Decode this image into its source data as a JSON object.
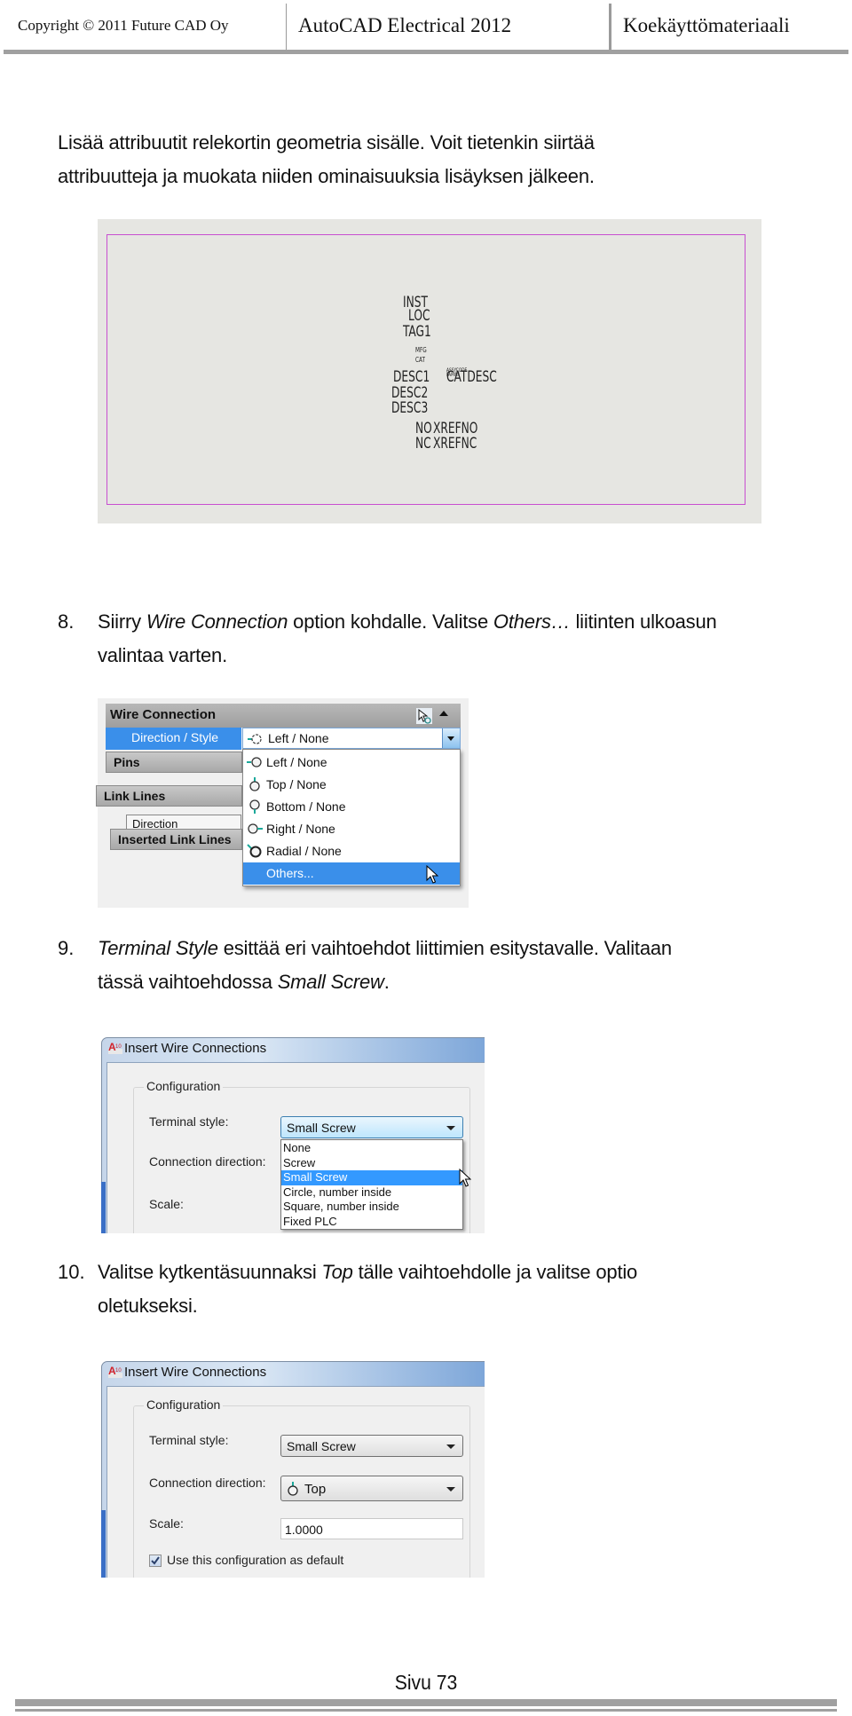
{
  "header": {
    "copyright": "Copyright © 2011 Future CAD Oy",
    "title": "AutoCAD Electrical 2012",
    "subtitle": "Koekäyttömateriaali"
  },
  "intro": {
    "line1": "Lisää attribuutit relekortin geometria sisälle. Voit tietenkin  siirtää",
    "line2": "attribuutteja ja muokata niiden ominaisuuksia lisäyksen jälkeen."
  },
  "cad_figure": {
    "frame_color": "#c84fd0",
    "attributes": {
      "inst": "INST",
      "loc": "LOC",
      "tag1": "TAG1",
      "mfg": "MFG",
      "cat": "CAT",
      "desc1": "DESC1",
      "desc2": "DESC2",
      "desc3": "DESC3",
      "assycode": "ASSYCODE",
      "family": "FAMILY",
      "catdesc": "CATDESC",
      "no": "NO",
      "xrefno": "XREFNO",
      "nc": "NC",
      "xrefnc": "XREFNC"
    }
  },
  "step8": {
    "number": "8.",
    "t1": "Siirry ",
    "t2_italic": "Wire Connection",
    "t3": " option kohdalle. Valitse ",
    "t4_italic": "Others…",
    "t5": " liitinten ulkoasun",
    "line2": "valintaa varten."
  },
  "wire_panel": {
    "header": "Wire Connection",
    "header_icons": [
      "pick-icon",
      "collapse-up-icon"
    ],
    "row_label": "Direction / Style",
    "combo_value": "Left / None",
    "sections": [
      "Pins",
      "Link Lines",
      "Inserted Link Lines"
    ],
    "direction_label": "Direction",
    "options": [
      {
        "label": "Left / None",
        "icon": "left-connection-icon"
      },
      {
        "label": "Top / None",
        "icon": "top-connection-icon"
      },
      {
        "label": "Bottom / None",
        "icon": "bottom-connection-icon"
      },
      {
        "label": "Right / None",
        "icon": "right-connection-icon"
      },
      {
        "label": "Radial / None",
        "icon": "radial-connection-icon"
      },
      {
        "label": "Others...",
        "icon": ""
      }
    ],
    "selected_option": "Others...",
    "accent": "#3a8fea"
  },
  "step9": {
    "number": "9.",
    "t1_italic": "Terminal Style",
    "t2": " esittää eri vaihtoehdot liittimien esitystavalle. Valitaan",
    "t3": "tässä vaihtoehdossa ",
    "t4_italic": "Small Screw",
    "t5": "."
  },
  "dialog1": {
    "title": "Insert Wire Connections",
    "group": "Configuration",
    "terminal_style_label": "Terminal style:",
    "terminal_style_value": "Small Screw",
    "connection_direction_label": "Connection direction:",
    "scale_label": "Scale:",
    "options": [
      "None",
      "Screw",
      "Small Screw",
      "Circle, number inside",
      "Square, number inside",
      "Fixed PLC"
    ],
    "selected_option": "Small Screw"
  },
  "step10": {
    "number": "10.",
    "t1": "Valitse kytkentäsuunnaksi ",
    "t2_italic": "Top",
    "t3": " tälle vaihtoehdolle ja valitse optio",
    "line2": "oletukseksi."
  },
  "dialog2": {
    "title": "Insert Wire Connections",
    "group": "Configuration",
    "terminal_style_label": "Terminal style:",
    "terminal_style_value": "Small Screw",
    "connection_direction_label": "Connection direction:",
    "connection_direction_value": "Top",
    "scale_label": "Scale:",
    "scale_value": "1.0000",
    "default_checkbox_label": "Use this configuration as default",
    "default_checked": true
  },
  "footer": {
    "page": "Sivu 73"
  }
}
